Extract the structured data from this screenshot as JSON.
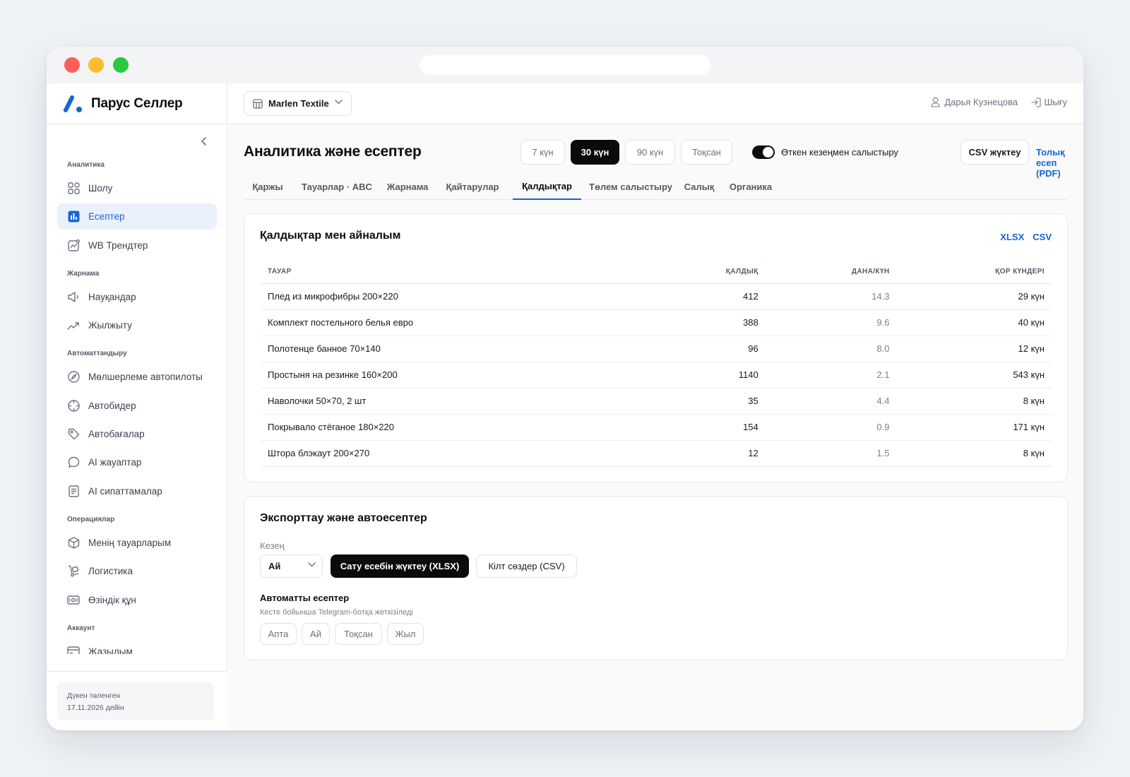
{
  "brand": {
    "name": "Парус Селлер",
    "accent": "#1565d8"
  },
  "sidebar": {
    "groups": [
      {
        "title": "Аналитика",
        "items": [
          {
            "label": "Шолу",
            "icon": "grid-icon"
          },
          {
            "label": "Есептер",
            "icon": "bar-chart-icon",
            "active": true
          },
          {
            "label": "WB Трендтер",
            "icon": "trend-chart-icon"
          }
        ]
      },
      {
        "title": "Жарнама",
        "items": [
          {
            "label": "Науқандар",
            "icon": "megaphone-icon"
          },
          {
            "label": "Жылжыту",
            "icon": "trending-up-icon"
          }
        ]
      },
      {
        "title": "Автоматтандыру",
        "items": [
          {
            "label": "Мөлшерлеме автопилоты",
            "icon": "compass-icon"
          },
          {
            "label": "Автобидер",
            "icon": "crosshair-icon"
          },
          {
            "label": "Автобағалар",
            "icon": "tag-icon"
          },
          {
            "label": "AI жауаптар",
            "icon": "chat-bubble-icon"
          },
          {
            "label": "AI сипаттамалар",
            "icon": "document-icon"
          }
        ]
      },
      {
        "title": "Операциялар",
        "items": [
          {
            "label": "Менің тауарларым",
            "icon": "box-icon"
          },
          {
            "label": "Логистика",
            "icon": "hand-truck-icon"
          },
          {
            "label": "Өзіндік құн",
            "icon": "money-icon"
          }
        ]
      },
      {
        "title": "Аккаунт",
        "items": [
          {
            "label": "Жазылым",
            "icon": "card-icon"
          }
        ]
      }
    ],
    "footer": {
      "paid_label": "Дүкен төленген",
      "paid_until": "17.11.2026 дейін"
    }
  },
  "topbar": {
    "store": "Marlen Textile",
    "user": "Дарья Кузнецова",
    "logout": "Шығу"
  },
  "page": {
    "title": "Аналитика және есептер",
    "periods": [
      "7 күн",
      "30 күн",
      "90 күн",
      "Тоқсан"
    ],
    "active_period": "30 күн",
    "compare_label": "Өткен кезеңмен салыстыру",
    "compare_on": true,
    "csv_button": "CSV жүктеу",
    "pdf_link": "Толық есеп (PDF)"
  },
  "tabs": [
    "Қаржы",
    "Тауарлар · ABC",
    "Жарнама",
    "Қайтарулар",
    "Қалдықтар",
    "Төлем салыстыру",
    "Салық",
    "Органика"
  ],
  "active_tab": "Қалдықтар",
  "stock": {
    "title": "Қалдықтар мен айналым",
    "links": [
      "XLSX",
      "CSV"
    ],
    "columns": [
      "ТАУАР",
      "ҚАЛДЫҚ",
      "ДАНА/КҮН",
      "ҚОР КҮНДЕРІ"
    ],
    "rows": [
      [
        "Плед из микрофибры 200×220",
        "412",
        "14.3",
        "29 күн"
      ],
      [
        "Комплект постельного белья евро",
        "388",
        "9.6",
        "40 күн"
      ],
      [
        "Полотенце банное 70×140",
        "96",
        "8.0",
        "12 күн"
      ],
      [
        "Простыня на резинке 160×200",
        "1140",
        "2.1",
        "543 күн"
      ],
      [
        "Наволочки 50×70, 2 шт",
        "35",
        "4.4",
        "8 күн"
      ],
      [
        "Покрывало стёганое 180×220",
        "154",
        "0.9",
        "171 күн"
      ],
      [
        "Штора блэкаут 200×270",
        "12",
        "1.5",
        "8 күн"
      ]
    ]
  },
  "export": {
    "title": "Экспорттау және автоесептер",
    "period_label": "Кезең",
    "period_value": "Ай",
    "sales_button": "Сату есебін жүктеу (XLSX)",
    "keywords_button": "Кілт сөздер (CSV)",
    "auto_title": "Автоматты есептер",
    "auto_sub": "Кесте бойынша Telegram-ботқа жеткізіледі",
    "chips": [
      "Апта",
      "Ай",
      "Тоқсан",
      "Жыл"
    ]
  }
}
